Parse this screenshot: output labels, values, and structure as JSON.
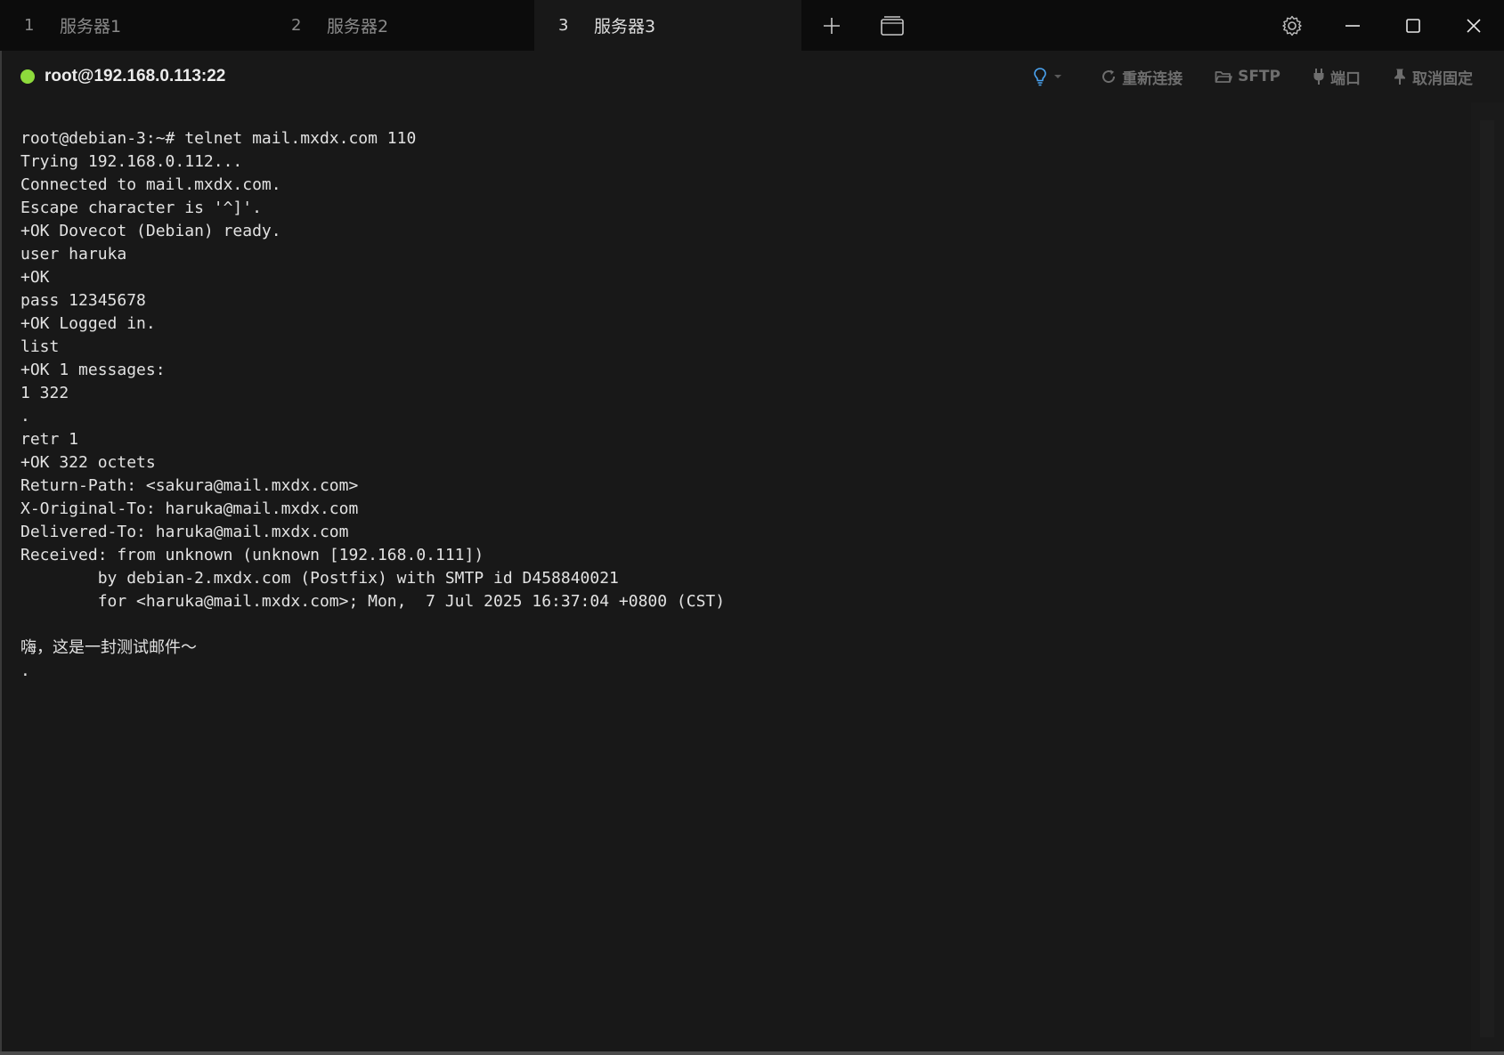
{
  "tabs": [
    {
      "number": "1",
      "label": "服务器1",
      "active": false
    },
    {
      "number": "2",
      "label": "服务器2",
      "active": false
    },
    {
      "number": "3",
      "label": "服务器3",
      "active": true
    }
  ],
  "session": {
    "host": "root@192.168.0.113:22",
    "status_color": "#8edb3c"
  },
  "toolbar": {
    "reconnect_label": "重新连接",
    "sftp_label": "SFTP",
    "port_label": "端口",
    "unpin_label": "取消固定"
  },
  "icons": {
    "new_tab": "plus-icon",
    "tab_layout": "window-icon",
    "settings": "gear-icon",
    "minimize": "minimize-icon",
    "maximize": "maximize-icon",
    "close": "close-icon",
    "bulb": "lightbulb-icon",
    "reconnect": "refresh-icon",
    "sftp": "folder-icon",
    "port": "plug-icon",
    "unpin": "pin-icon"
  },
  "colors": {
    "accent_bulb": "#4aa3f0",
    "background": "#181818"
  },
  "terminal": {
    "output": "root@debian-3:~# telnet mail.mxdx.com 110\nTrying 192.168.0.112...\nConnected to mail.mxdx.com.\nEscape character is '^]'.\n+OK Dovecot (Debian) ready.\nuser haruka\n+OK\npass 12345678\n+OK Logged in.\nlist\n+OK 1 messages:\n1 322\n.\nretr 1\n+OK 322 octets\nReturn-Path: <sakura@mail.mxdx.com>\nX-Original-To: haruka@mail.mxdx.com\nDelivered-To: haruka@mail.mxdx.com\nReceived: from unknown (unknown [192.168.0.111])\n        by debian-2.mxdx.com (Postfix) with SMTP id D458840021\n        for <haruka@mail.mxdx.com>; Mon,  7 Jul 2025 16:37:04 +0800 (CST)\n\n嗨，这是一封测试邮件～\n."
  }
}
